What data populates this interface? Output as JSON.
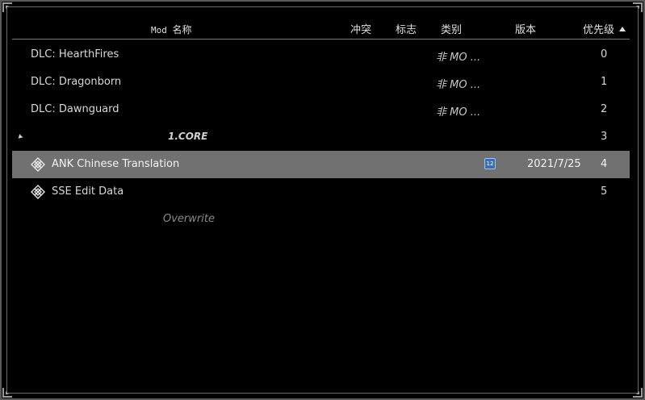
{
  "header": {
    "name_ascii": "Mod",
    "name_cjk": "名称",
    "conflict": "冲突",
    "flags": "标志",
    "category": "类别",
    "version": "版本",
    "priority": "优先级"
  },
  "rows": [
    {
      "name": "DLC: HearthFires",
      "category": "非 MO ...",
      "version": "",
      "priority": "0"
    },
    {
      "name": "DLC: Dragonborn",
      "category": "非 MO ...",
      "version": "",
      "priority": "1"
    },
    {
      "name": "DLC: Dawnguard",
      "category": "非 MO ...",
      "version": "",
      "priority": "2"
    },
    {
      "separator": "1.CORE",
      "priority": "3"
    },
    {
      "name": "ANK Chinese Translation",
      "category": "",
      "version": "2021/7/25",
      "priority": "4",
      "selected": true,
      "version_icon_text": "12"
    },
    {
      "name": "SSE Edit Data",
      "category": "",
      "version": "",
      "priority": "5"
    },
    {
      "overwrite": "Overwrite"
    }
  ],
  "colors": {
    "background": "#000000",
    "selected_row": "#717171",
    "text": "#d8d8d8",
    "muted_text": "#8a8a8a",
    "version_icon": "#3b6fb0"
  },
  "icons": {
    "mod_icon": "diamond-lattice-icon",
    "collapse": "collapse-triangle-icon",
    "version_icon": "calendar-icon",
    "sort": "sort-ascending-icon"
  }
}
